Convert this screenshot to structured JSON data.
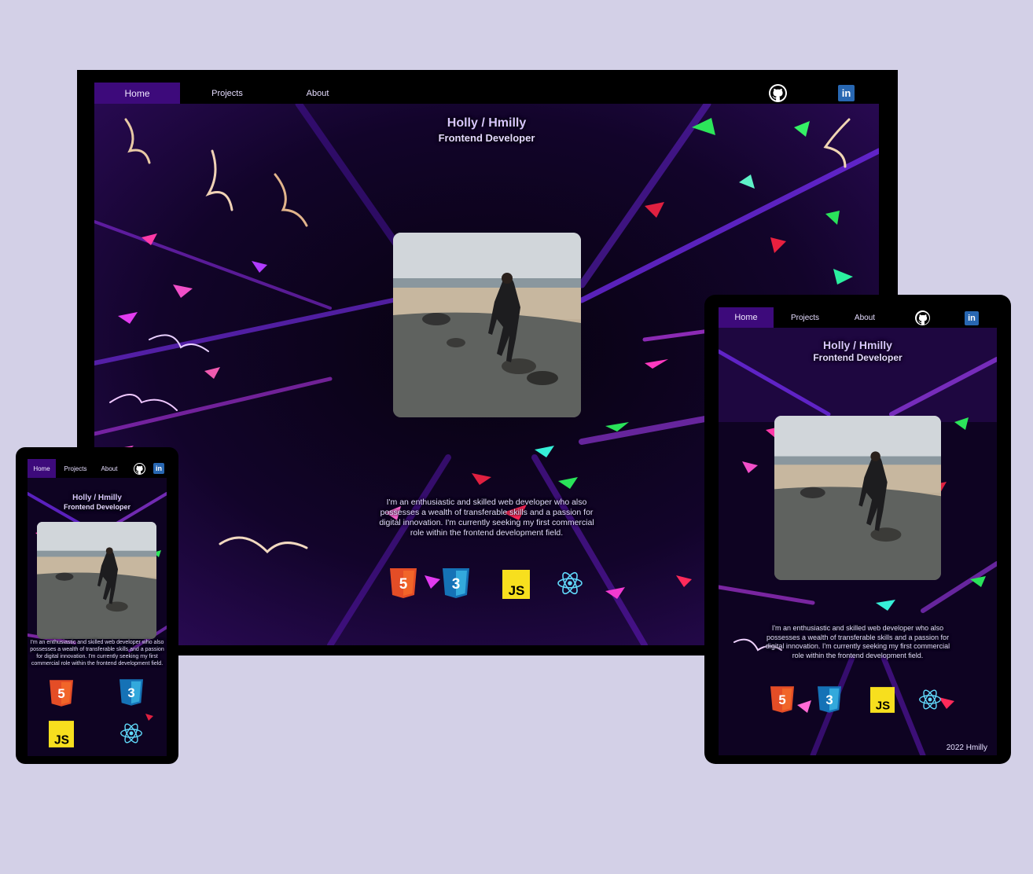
{
  "site": {
    "nav": {
      "home": "Home",
      "projects": "Projects",
      "about": "About"
    },
    "icons": {
      "github": "github-icon",
      "linkedin": "linkedin-icon"
    },
    "linkedin_text": "in",
    "name": "Holly / Hmilly",
    "role": "Frontend Developer",
    "about": "I'm an enthusiastic and skilled web developer who also possesses a wealth of transferable skills and a passion for digital innovation. I'm currently seeking my first commercial role within the frontend development field.",
    "skills": [
      {
        "icon": "html5-icon",
        "label": "5",
        "color": "#e44d26"
      },
      {
        "icon": "css3-icon",
        "label": "3",
        "color": "#2965f1"
      },
      {
        "icon": "javascript-icon",
        "label": "JS",
        "color": "#f7df1e"
      },
      {
        "icon": "react-icon",
        "label": "",
        "color": "#61dafb"
      }
    ],
    "footer": "2022 Hmilly"
  },
  "colors": {
    "page_background": "#d3d0e7",
    "nav_active": "#3d0a7b",
    "heading": "#d8c6ff"
  }
}
